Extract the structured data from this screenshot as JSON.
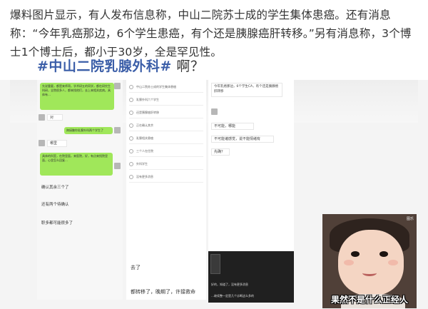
{
  "article": {
    "paragraph": "爆料图片显示，有人发布信息称，中山二院苏士成的学生集体患癌。还有消息称：“今年乳癌那边，6个学生患癌，有个还是胰腺癌肝转移。”另有消息称，3个博士1个博士后，都小于30岁，全是罕见性。"
  },
  "post": {
    "hashtag": "#中山二院乳腺外科#",
    "suffix": " 啊？"
  },
  "chat1": {
    "green1": "先说重要，都是来师哥，学术研五的同学，都在研究生科研，全院很多人，都来找他们，去上来相关疾病。具体有…",
    "white1": "对",
    "green2": "跨接触你乳腺外科两个学生了",
    "white2": "哪里",
    "green3": "具体的科室，在院里面，来医院，好，有点来找院里面，心里怎么回复…",
    "line1": "确认其余三个了",
    "line2": "还有两个待确认",
    "line3": "职多都可能很多了"
  },
  "chat2": {
    "rows": [
      "中山二院苏士成的学生集体患癌",
      "乳腺外科六个学生",
      "还是胰腺癌肝转移",
      "正在确认其余",
      "乳腺相关患癌",
      "三个人在住院",
      "外科学生",
      "没有更多消息"
    ],
    "line1": "去了",
    "line2": "都转移了，晚期了，许接救命"
  },
  "chat3": {
    "line1": "今年乳癌那边，6个学生CA，有个还是胰腺癌肝转移",
    "line2": "不可能，哪能",
    "line3": "不可能诸感觉，说不能情绪有",
    "line4": "先确？",
    "dark1": "好的，知道了，没有更多消息",
    "dark2": "…继续整一定是几个诊断这么多的"
  },
  "meme": {
    "corner": "图乐",
    "caption": "果然不是什么正经人"
  }
}
